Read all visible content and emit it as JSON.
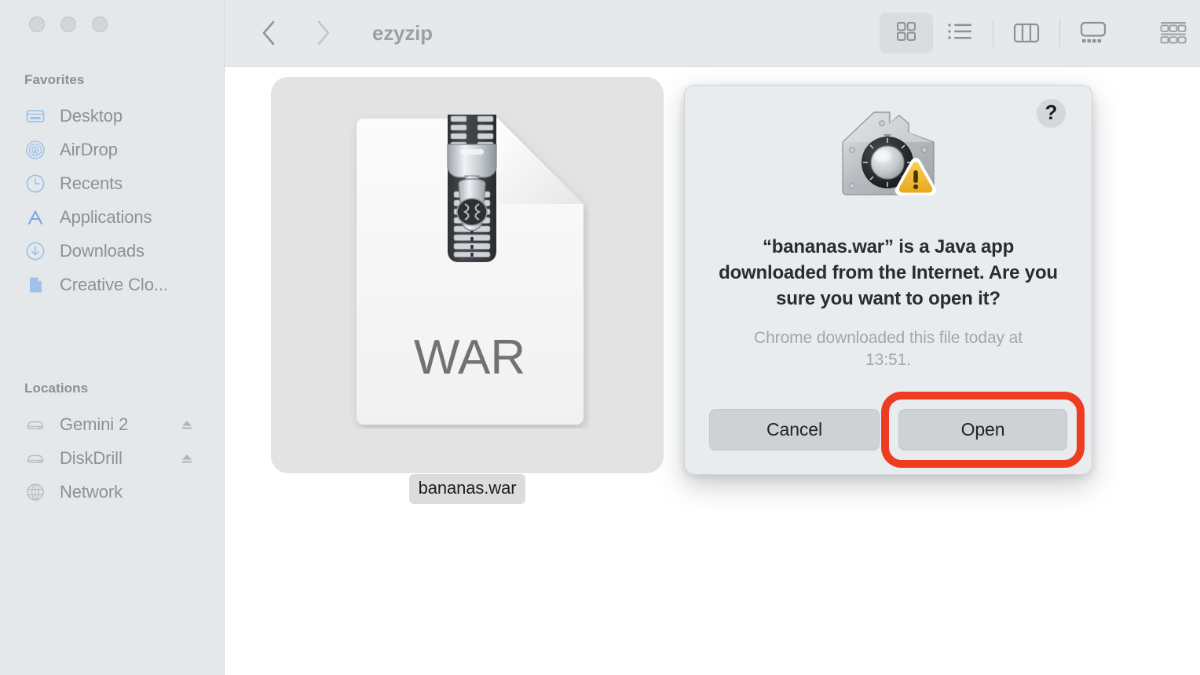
{
  "window": {
    "traffic_lights": [
      "close-button",
      "minimize-button",
      "maximize-button"
    ]
  },
  "toolbar": {
    "back_icon": "chevron-left-icon",
    "forward_icon": "chevron-right-icon",
    "folder_title": "ezyzip",
    "view_modes": [
      {
        "id": "icon-view",
        "icon": "grid-view-icon",
        "active": true
      },
      {
        "id": "list-view",
        "icon": "list-view-icon",
        "active": false
      },
      {
        "id": "column-view",
        "icon": "column-view-icon",
        "active": false
      },
      {
        "id": "gallery-view",
        "icon": "gallery-view-icon",
        "active": false
      }
    ],
    "group_button_icon": "group-by-icon"
  },
  "sidebar": {
    "sections": [
      {
        "header": "Favorites",
        "items": [
          {
            "label": "Desktop",
            "icon": "desktop-icon"
          },
          {
            "label": "AirDrop",
            "icon": "airdrop-icon"
          },
          {
            "label": "Recents",
            "icon": "clock-icon"
          },
          {
            "label": "Applications",
            "icon": "applications-icon"
          },
          {
            "label": "Downloads",
            "icon": "download-arrow-icon"
          },
          {
            "label": "Creative Clo...",
            "icon": "document-icon"
          }
        ]
      },
      {
        "header": "Locations",
        "items": [
          {
            "label": "Gemini 2",
            "icon": "external-drive-icon",
            "eject": true
          },
          {
            "label": "DiskDrill",
            "icon": "external-drive-icon",
            "eject": true
          },
          {
            "label": "Network",
            "icon": "globe-icon",
            "eject": false
          }
        ]
      }
    ]
  },
  "content": {
    "file": {
      "name": "bananas.war",
      "icon": "zip-archive-document-icon",
      "icon_type_label": "WAR",
      "selected": true
    }
  },
  "dialog": {
    "icon": "security-gatekeeper-warning-icon",
    "help_label": "?",
    "title": "“bananas.war” is a Java app downloaded from the Internet. Are you sure you want to open it?",
    "subtitle": "Chrome downloaded this file today at 13:51.",
    "buttons": {
      "cancel": "Cancel",
      "open": "Open"
    },
    "highlighted_button": "Open"
  },
  "colors": {
    "sidebar_bg": "#e4e8ea",
    "toolbar_bg": "#e5e9eb",
    "content_bg": "#ffffff",
    "dialog_bg": "#e8ecee",
    "selection_tile": "#e3e3e3",
    "highlight_red": "#ee3c22",
    "sidebar_text": "#8c9196",
    "sidebar_icon_blue": "#9dc3ea",
    "warning_yellow": "#f0bc2c"
  }
}
